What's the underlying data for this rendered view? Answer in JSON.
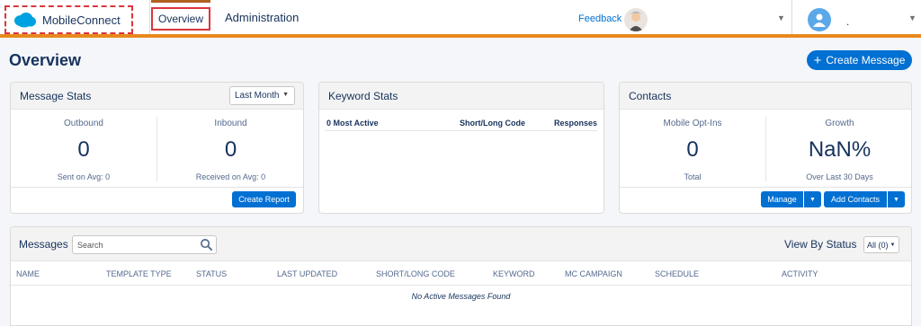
{
  "nav": {
    "app_name": "MobileConnect",
    "tabs": [
      {
        "label": "Overview"
      },
      {
        "label": "Administration"
      }
    ],
    "feedback": "Feedback",
    "user_name": "."
  },
  "page": {
    "title": "Overview",
    "create_message": "Create Message"
  },
  "message_stats": {
    "title": "Message Stats",
    "period": "Last Month",
    "outbound_label": "Outbound",
    "outbound_value": "0",
    "outbound_sub": "Sent on Avg: 0",
    "inbound_label": "Inbound",
    "inbound_value": "0",
    "inbound_sub": "Received on Avg: 0",
    "create_report": "Create Report"
  },
  "keyword_stats": {
    "title": "Keyword Stats",
    "columns": [
      "0 Most Active",
      "Short/Long Code",
      "Responses"
    ]
  },
  "contacts": {
    "title": "Contacts",
    "optins_label": "Mobile Opt-Ins",
    "optins_value": "0",
    "optins_sub": "Total",
    "growth_label": "Growth",
    "growth_value": "NaN%",
    "growth_sub": "Over Last 30 Days",
    "manage": "Manage",
    "add_contacts": "Add Contacts"
  },
  "messages": {
    "title": "Messages",
    "search_placeholder": "Search",
    "view_by_status": "View By Status",
    "status_filter": "All (0)",
    "columns": [
      "NAME",
      "TEMPLATE TYPE",
      "STATUS",
      "LAST UPDATED",
      "SHORT/LONG CODE",
      "KEYWORD",
      "MC CAMPAIGN",
      "SCHEDULE",
      "ACTIVITY"
    ],
    "empty": "No Active Messages Found"
  },
  "colors": {
    "brand_blue": "#0070d2",
    "accent_orange": "#e8891c",
    "highlight_red": "#d9363e"
  }
}
